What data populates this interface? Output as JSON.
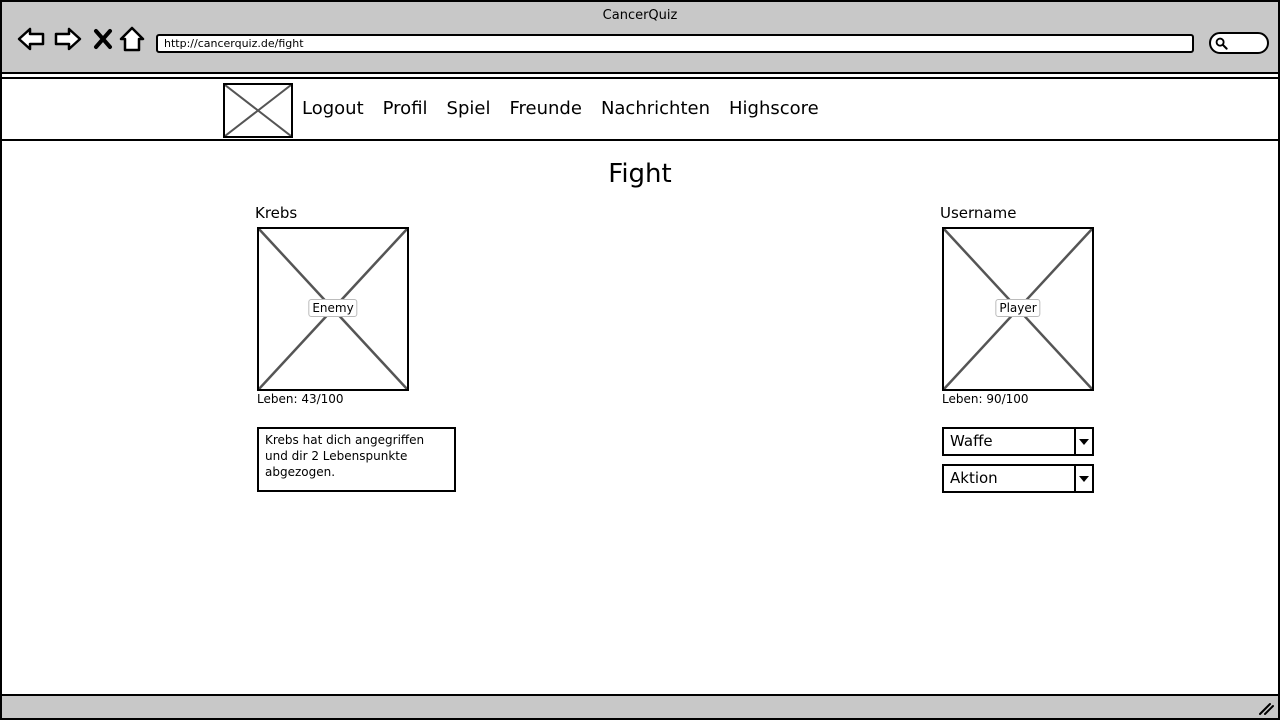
{
  "window": {
    "title": "CancerQuiz",
    "url": "http://cancerquiz.de/fight"
  },
  "icons": [
    "back-icon",
    "forward-icon",
    "close-icon",
    "home-icon",
    "search-icon",
    "resize-grip-icon"
  ],
  "nav": {
    "items": [
      "Logout",
      "Profil",
      "Spiel",
      "Freunde",
      "Nachrichten",
      "Highscore"
    ]
  },
  "page": {
    "title": "Fight"
  },
  "enemy": {
    "name": "Krebs",
    "image_label": "Enemy",
    "life": "Leben: 43/100"
  },
  "player": {
    "name": "Username",
    "image_label": "Player",
    "life": "Leben: 90/100"
  },
  "message": "Krebs hat dich angegriffen und dir 2 Lebenspunkte abgezogen.",
  "controls": {
    "weapon": "Waffe",
    "action": "Aktion"
  }
}
